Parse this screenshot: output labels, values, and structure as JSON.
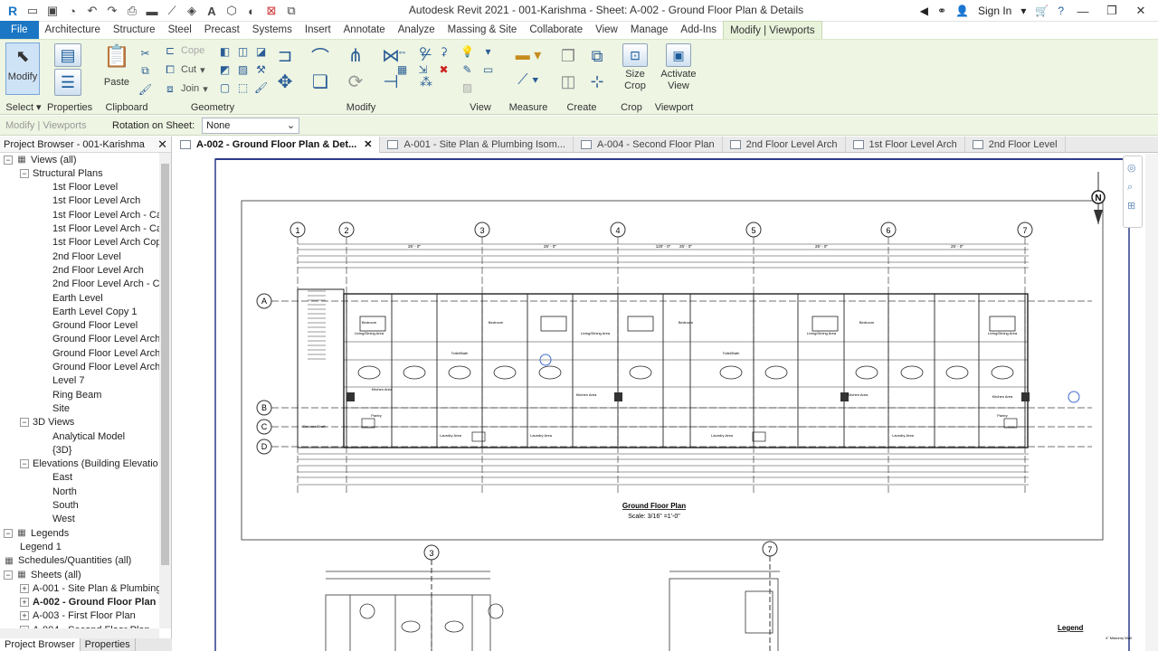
{
  "titlebar": {
    "title": "Autodesk Revit 2021 - 001-Karishma - Sheet: A-002 - Ground Floor Plan & Details",
    "sign_in": "Sign In",
    "quick_icons": [
      "revit-logo-icon",
      "open-icon",
      "save-icon",
      "sync-icon",
      "undo-icon",
      "redo-icon",
      "print-icon",
      "measure-icon",
      "dimension-icon",
      "tag-icon",
      "text-icon",
      "3d-view-icon",
      "section-icon",
      "close-hidden-icon",
      "switch-windows-icon"
    ]
  },
  "ribbon_tabs": [
    "File",
    "Architecture",
    "Structure",
    "Steel",
    "Precast",
    "Systems",
    "Insert",
    "Annotate",
    "Analyze",
    "Massing & Site",
    "Collaborate",
    "View",
    "Manage",
    "Add-Ins",
    "Modify | Viewports"
  ],
  "ribbon": {
    "modify": "Modify",
    "select": "Select",
    "properties": "Properties",
    "paste": "Paste",
    "clipboard": "Clipboard",
    "cope": "Cope",
    "cut": "Cut",
    "join": "Join",
    "geometry": "Geometry",
    "modify_panel": "Modify",
    "view": "View",
    "measure": "Measure",
    "create": "Create",
    "size_crop": "Size Crop",
    "crop": "Crop",
    "activate_view": "Activate View",
    "viewport": "Viewport"
  },
  "optbar": {
    "context": "Modify | Viewports",
    "rotation_label": "Rotation on Sheet:",
    "rotation_value": "None"
  },
  "browser": {
    "title": "Project Browser - 001-Karishma",
    "tabs": [
      "Project Browser",
      "Properties"
    ],
    "items": [
      {
        "label": "Views (all)",
        "level": 0,
        "toggle": "−",
        "icon": "views-icon"
      },
      {
        "label": "Structural Plans",
        "level": 1,
        "toggle": "−"
      },
      {
        "label": "1st Floor Level",
        "level": 2
      },
      {
        "label": "1st Floor Level Arch",
        "level": 2
      },
      {
        "label": "1st Floor Level Arch - Cal",
        "level": 2
      },
      {
        "label": "1st Floor Level Arch - Cal",
        "level": 2
      },
      {
        "label": "1st Floor Level Arch Copy",
        "level": 2
      },
      {
        "label": "2nd Floor Level",
        "level": 2
      },
      {
        "label": "2nd Floor Level Arch",
        "level": 2
      },
      {
        "label": "2nd Floor Level Arch - Ca",
        "level": 2
      },
      {
        "label": "Earth Level",
        "level": 2
      },
      {
        "label": "Earth Level Copy 1",
        "level": 2
      },
      {
        "label": "Ground Floor Level",
        "level": 2
      },
      {
        "label": "Ground Floor Level Arch",
        "level": 2
      },
      {
        "label": "Ground Floor Level Arch",
        "level": 2
      },
      {
        "label": "Ground Floor Level Arch",
        "level": 2
      },
      {
        "label": "Level 7",
        "level": 2
      },
      {
        "label": "Ring Beam",
        "level": 2
      },
      {
        "label": "Site",
        "level": 2
      },
      {
        "label": "3D Views",
        "level": 1,
        "toggle": "−"
      },
      {
        "label": "Analytical Model",
        "level": 2
      },
      {
        "label": "{3D}",
        "level": 2
      },
      {
        "label": "Elevations (Building Elevatio",
        "level": 1,
        "toggle": "−"
      },
      {
        "label": "East",
        "level": 2
      },
      {
        "label": "North",
        "level": 2
      },
      {
        "label": "South",
        "level": 2
      },
      {
        "label": "West",
        "level": 2
      },
      {
        "label": "Legends",
        "level": 0,
        "toggle": "−",
        "icon": "legend-icon"
      },
      {
        "label": "Legend 1",
        "level": 1
      },
      {
        "label": "Schedules/Quantities (all)",
        "level": 0,
        "icon": "schedule-icon"
      },
      {
        "label": "Sheets (all)",
        "level": 0,
        "toggle": "−",
        "icon": "sheets-icon"
      },
      {
        "label": "A-001 - Site Plan & Plumbing",
        "level": 1,
        "toggle": "+"
      },
      {
        "label": "A-002 - Ground Floor Plan &",
        "level": 1,
        "toggle": "+",
        "bold": true
      },
      {
        "label": "A-003 - First Floor Plan",
        "level": 1,
        "toggle": "+"
      },
      {
        "label": "A-004 - Second Floor Plan",
        "level": 1,
        "toggle": "+"
      }
    ]
  },
  "view_tabs": [
    {
      "label": "A-002 - Ground Floor Plan & Det...",
      "active": true
    },
    {
      "label": "A-001 - Site Plan & Plumbing Isom..."
    },
    {
      "label": "A-004 - Second Floor Plan"
    },
    {
      "label": "2nd Floor Level Arch"
    },
    {
      "label": "1st Floor Level Arch"
    },
    {
      "label": "2nd Floor Level"
    }
  ],
  "drawing": {
    "grid_top": [
      "1",
      "2",
      "3",
      "4",
      "5",
      "6",
      "7"
    ],
    "grid_left": [
      "A",
      "B",
      "C",
      "D"
    ],
    "plan_title": "Ground Floor Plan",
    "plan_scale": "Scale: 3/16\" =1'-0\"",
    "detail_grid_left": "3",
    "detail_grid_right": "7",
    "legend": "Legend",
    "legend_item": "4\" Masonry Wall",
    "north": "N",
    "room_labels": [
      "Bedroom",
      "Living/Dining Area",
      "Toilet/Bath",
      "Kitchen Area",
      "Laundry Area",
      "Bedroom",
      "Elevator Shaft",
      "Pantry"
    ],
    "dims_top": [
      "120' - 0\"",
      "25' - 0\"",
      "25' - 0\"",
      "25' - 0\"",
      "25' - 0\"",
      "25' - 0\""
    ]
  }
}
